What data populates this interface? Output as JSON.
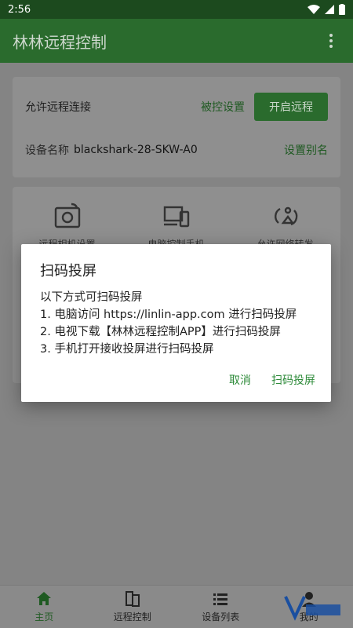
{
  "status": {
    "time": "2:56"
  },
  "appbar": {
    "title": "林林远程控制"
  },
  "card1": {
    "allow_label": "允许远程连接",
    "controlled_settings": "被控设置",
    "start_button": "开启远程",
    "device_label": "设备名称",
    "device_name": "blackshark-28-SKW-A0",
    "alias_link": "设置别名"
  },
  "features": [
    {
      "label": "远程相机设置",
      "icon": "camera-icon"
    },
    {
      "label": "电脑控制手机",
      "icon": "devices-icon"
    },
    {
      "label": "允许网络转发",
      "icon": "network-icon"
    }
  ],
  "dialog": {
    "title": "扫码投屏",
    "lines": [
      "以下方式可扫码投屏",
      "1. 电脑访问 https://linlin-app.com 进行扫码投屏",
      "2. 电视下载【林林远程控制APP】进行扫码投屏",
      "3. 手机打开接收投屏进行扫码投屏"
    ],
    "cancel": "取消",
    "confirm": "扫码投屏"
  },
  "nav": [
    {
      "label": "主页",
      "icon": "home-icon",
      "active": true
    },
    {
      "label": "远程控制",
      "icon": "remote-icon",
      "active": false
    },
    {
      "label": "设备列表",
      "icon": "list-icon",
      "active": false
    },
    {
      "label": "我的",
      "icon": "user-icon",
      "active": false
    }
  ],
  "colors": {
    "primary": "#2a6b2d",
    "accent": "#2e8b3a"
  }
}
